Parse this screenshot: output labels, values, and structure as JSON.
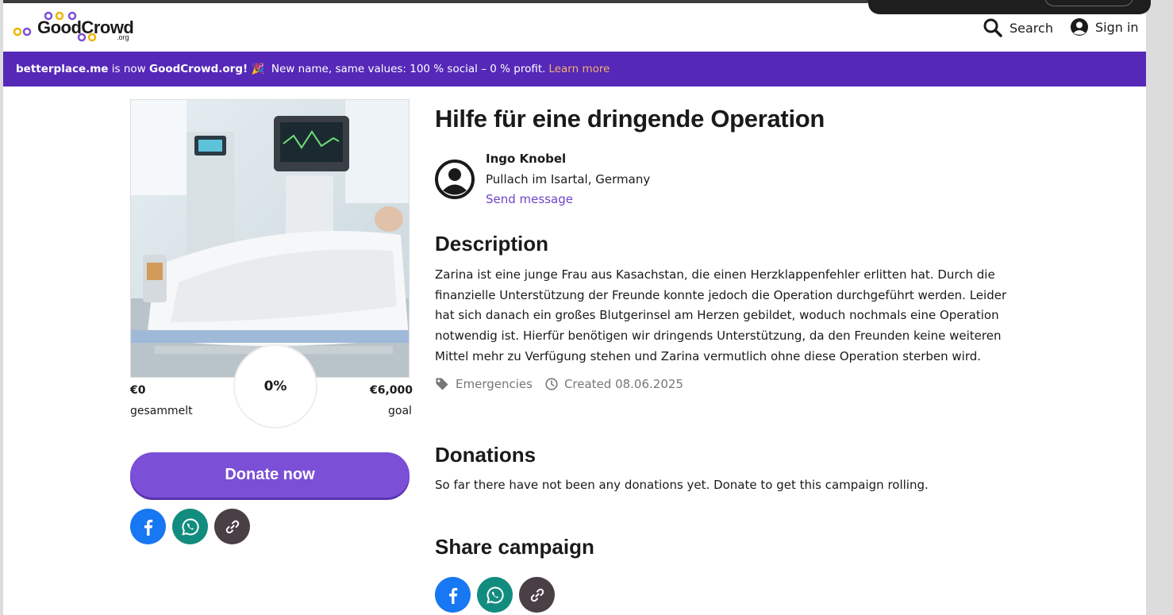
{
  "header": {
    "logo_text": "GoodCrowd",
    "logo_sub": ".org",
    "search_label": "Search",
    "signin_label": "Sign in"
  },
  "banner": {
    "old_name": "betterplace.me",
    "is_now": "is now",
    "new_name": "GoodCrowd.org!",
    "emoji": "🎉",
    "tagline": "New name, same values: 100 % social – 0 % profit.",
    "learn_more": "Learn more"
  },
  "campaign": {
    "title": "Hilfe für eine dringende Operation",
    "progress": "0%",
    "raised": "€0",
    "raised_label": "gesammelt",
    "goal": "€6,000",
    "goal_label": "goal",
    "donate_label": "Donate now"
  },
  "owner": {
    "name": "Ingo Knobel",
    "location": "Pullach im Isartal, Germany",
    "send_message": "Send message"
  },
  "description": {
    "heading": "Description",
    "text": "Zarina ist eine junge Frau aus Kasachstan, die einen Herzklappenfehler erlitten hat. Durch die finanzielle Unterstützung der Freunde konnte jedoch die Operation durchgeführt werden. Leider hat sich danach ein großes Blutgerinsel am Herzen gebildet, woduch nochmals eine Operation notwendig ist. Hierfür benötigen wir dringends Unterstützung, da den Freunden keine weiteren Mittel mehr zu Verfügung stehen und Zarina vermutlich ohne diese Operation sterben wird.",
    "category": "Emergencies",
    "created": "Created 08.06.2025"
  },
  "donations": {
    "heading": "Donations",
    "text": "So far there have not been any donations yet. Donate to get this campaign rolling."
  },
  "share": {
    "heading": "Share campaign",
    "buttons": [
      "facebook-icon",
      "whatsapp-icon",
      "link-icon"
    ]
  },
  "colors": {
    "banner": "#5528b8",
    "accent": "#7b4fd6",
    "link": "#6e45c9",
    "facebook": "#1877f2",
    "whatsapp": "#128c7e",
    "copy_link": "#4a3f45"
  }
}
